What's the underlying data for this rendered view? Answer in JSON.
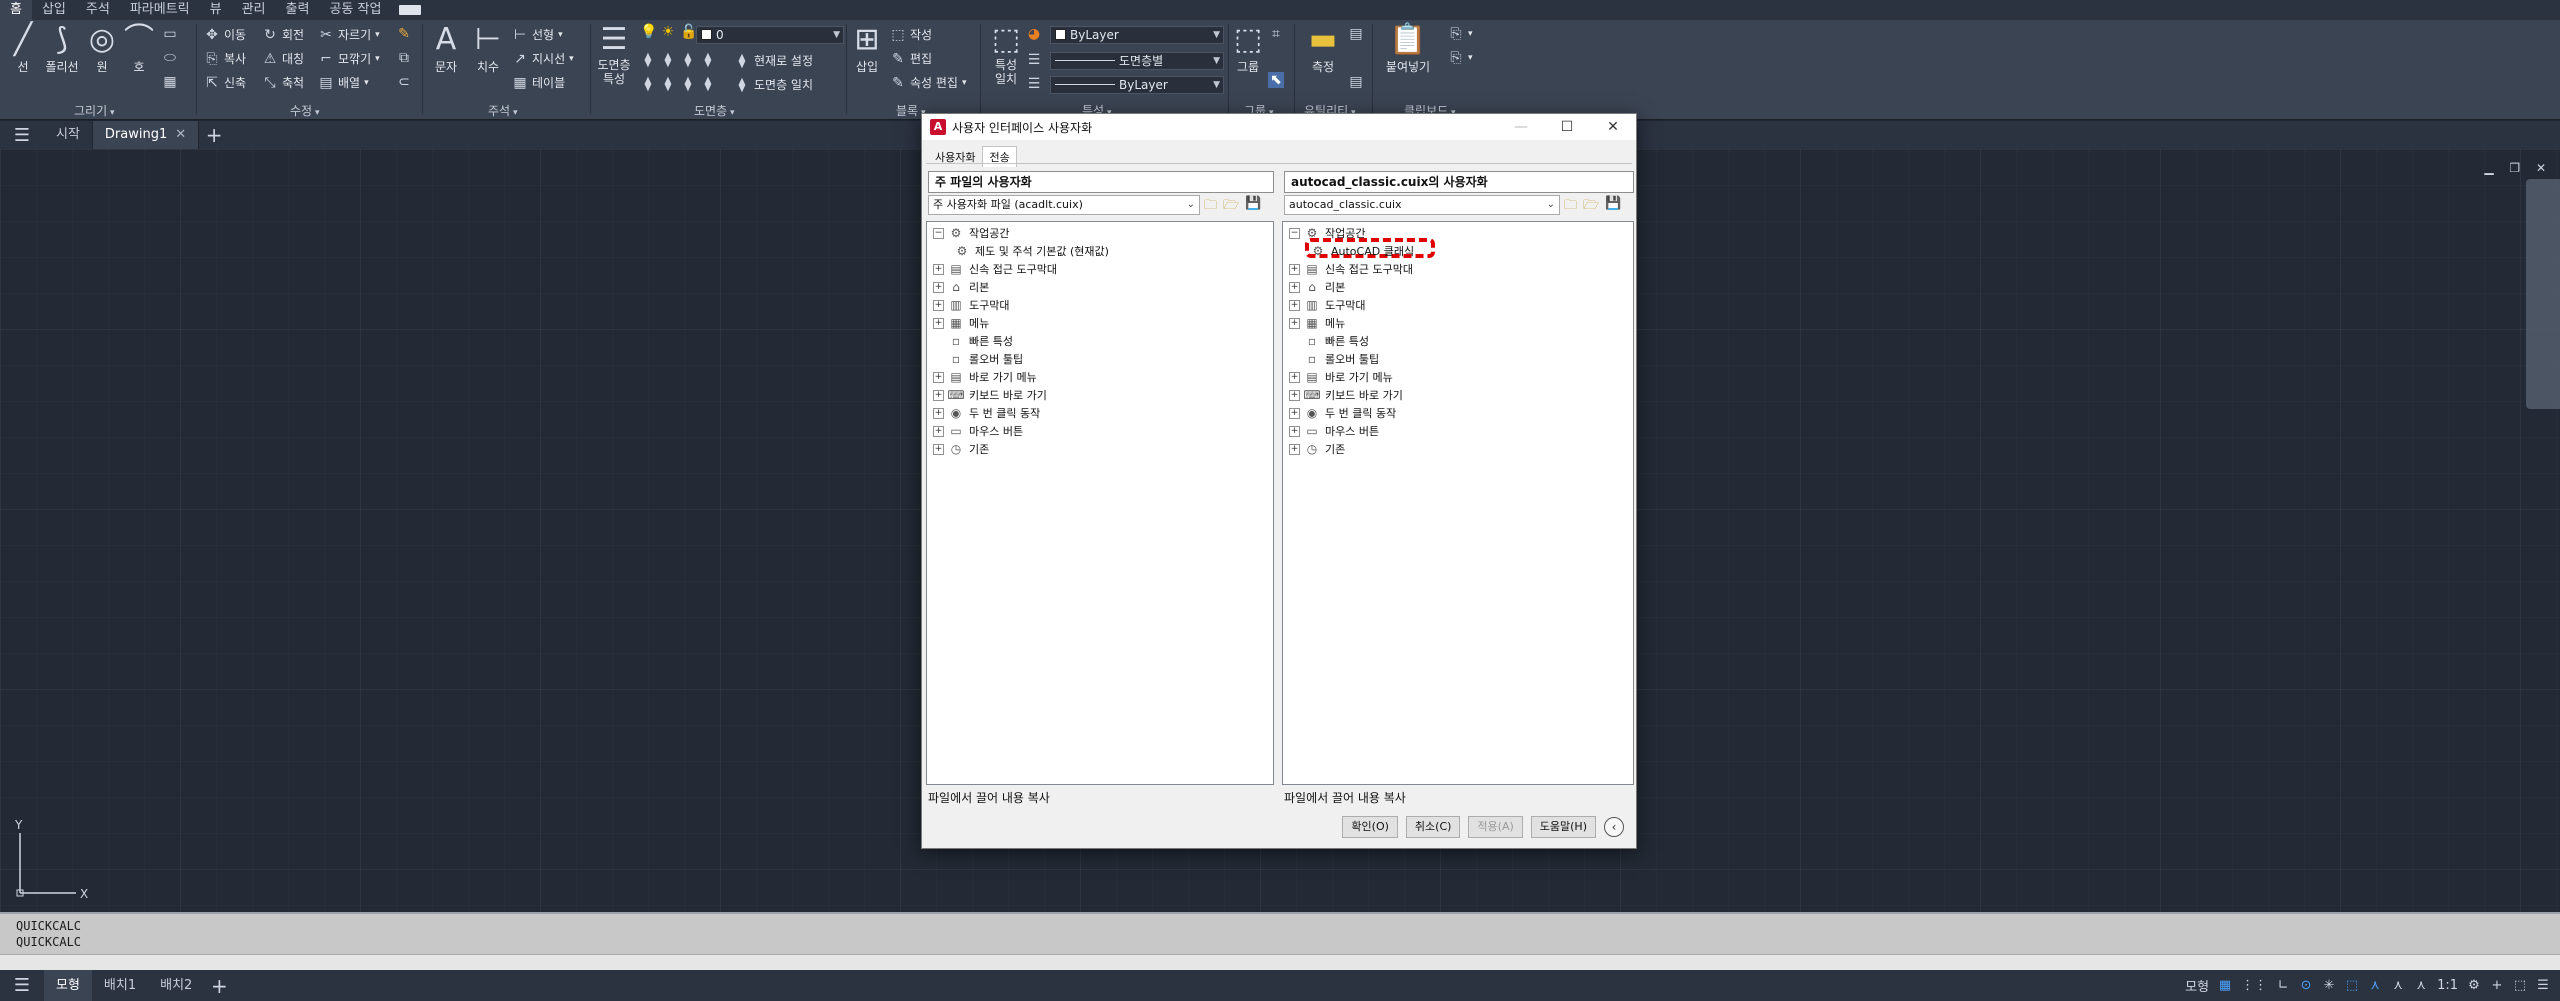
{
  "ribbon_tabs": [
    "홈",
    "삽입",
    "주석",
    "파라메트릭",
    "뷰",
    "관리",
    "출력",
    "공동 작업"
  ],
  "ribbon": {
    "draw": {
      "label": "그리기",
      "line": "선",
      "polyline": "폴리선",
      "circle": "원",
      "arc": "호"
    },
    "modify": {
      "label": "수정",
      "move": "이동",
      "rotate": "회전",
      "trim": "자르기",
      "copy": "복사",
      "mirror": "대칭",
      "fillet": "모깎기",
      "stretch": "신축",
      "scale": "축척",
      "array": "배열"
    },
    "annotation": {
      "label": "주석",
      "text": "문자",
      "dimension": "치수",
      "linear": "선형",
      "leader": "지시선",
      "table": "테이블"
    },
    "layers": {
      "label": "도면층",
      "layer_props": "도면층 특성",
      "layer_name": "0",
      "make_current": "현재로 설정",
      "match_layer": "도면층 일치"
    },
    "block": {
      "label": "블록",
      "insert": "삽입",
      "create": "작성",
      "edit": "편집",
      "edit_attr": "속성 편집"
    },
    "properties": {
      "label": "특성",
      "match": "특성 일치",
      "color": "ByLayer",
      "linetype": "도면층별",
      "lineweight": "ByLayer"
    },
    "groups": {
      "label": "그룹",
      "group": "그룹"
    },
    "utilities": {
      "label": "유틸리티",
      "measure": "측정"
    },
    "clipboard": {
      "label": "클립보드",
      "paste": "붙여넣기"
    }
  },
  "doc_tabs": {
    "start": "시작",
    "drawing": "Drawing1"
  },
  "command_history": [
    "QUICKCALC",
    "QUICKCALC"
  ],
  "layout_tabs": [
    "모형",
    "배치1",
    "배치2"
  ],
  "status": {
    "model": "모형",
    "scale": "1:1"
  },
  "dialog": {
    "title": "사용자 인터페이스 사용자화",
    "tabs": [
      "사용자화",
      "전송"
    ],
    "left": {
      "header": "주 파일의 사용자화",
      "file": "주 사용자화 파일 (acadlt.cuix)",
      "footer": "파일에서 끌어 내용 복사",
      "tree": {
        "workspaces": "작업공간",
        "default_ws": "제도 및 주석 기본값 (현재값)",
        "quick_access": "신속 접근 도구막대",
        "ribbon": "리본",
        "toolbars": "도구막대",
        "menus": "메뉴",
        "quick_props": "빠른 특성",
        "rollover": "롤오버 툴팁",
        "shortcut_menus": "바로 가기 메뉴",
        "keyboard": "키보드 바로 가기",
        "double_click": "두 번 클릭 동작",
        "mouse": "마우스 버튼",
        "legacy": "기존"
      }
    },
    "right": {
      "header": "autocad_classic.cuix의 사용자화",
      "file": "autocad_classic.cuix",
      "footer": "파일에서 끌어 내용 복사",
      "tree": {
        "workspaces": "작업공간",
        "classic_ws": "AutoCAD 클래식",
        "quick_access": "신속 접근 도구막대",
        "ribbon": "리본",
        "toolbars": "도구막대",
        "menus": "메뉴",
        "quick_props": "빠른 특성",
        "rollover": "롤오버 툴팁",
        "shortcut_menus": "바로 가기 메뉴",
        "keyboard": "키보드 바로 가기",
        "double_click": "두 번 클릭 동작",
        "mouse": "마우스 버튼",
        "legacy": "기존"
      }
    },
    "buttons": {
      "ok": "확인(O)",
      "cancel": "취소(C)",
      "apply": "적용(A)",
      "help": "도움말(H)"
    }
  }
}
